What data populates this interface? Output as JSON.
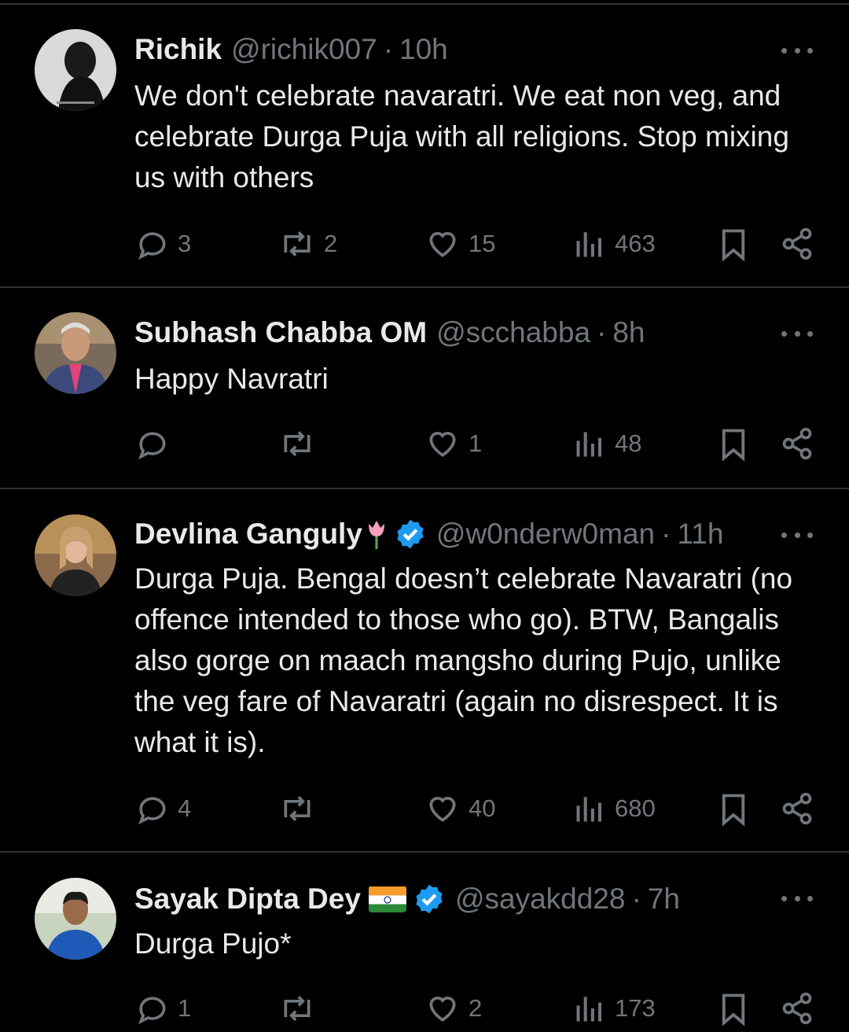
{
  "tweets": [
    {
      "name": "Richik",
      "handle": "@richik007",
      "time": "10h",
      "text": "We don't celebrate navaratri. We eat non veg, and celebrate Durga Puja with all religions. Stop mixing us with others",
      "replies": "3",
      "retweets": "2",
      "likes": "15",
      "views": "463",
      "verified": false
    },
    {
      "name": "Subhash Chabba OM",
      "handle": "@scchabba",
      "time": "8h",
      "text": "Happy Navratri",
      "replies": "",
      "retweets": "",
      "likes": "1",
      "views": "48",
      "verified": false
    },
    {
      "name": "Devlina Ganguly",
      "name_emoji": "tulip-emoji",
      "handle": "@w0nderw0man",
      "time": "11h",
      "text": "Durga Puja. Bengal doesn’t celebrate Navaratri (no offence intended to those who go). BTW, Bangalis also gorge on maach mangsho during Pujo, unlike the veg fare of Navaratri (again no disrespect. It is what it is).",
      "replies": "4",
      "retweets": "",
      "likes": "40",
      "views": "680",
      "verified": true
    },
    {
      "name": "Sayak Dipta Dey",
      "name_emoji": "india-flag-emoji",
      "handle": "@sayakdd28",
      "time": "7h",
      "text": "Durga Pujo*",
      "replies": "1",
      "retweets": "",
      "likes": "2",
      "views": "173",
      "verified": true
    }
  ],
  "separator": "·",
  "colors": {
    "background": "#000000",
    "text": "#e7e9ea",
    "muted": "#71767b",
    "divider": "#2f3336",
    "verified": "#1d9bf0"
  }
}
